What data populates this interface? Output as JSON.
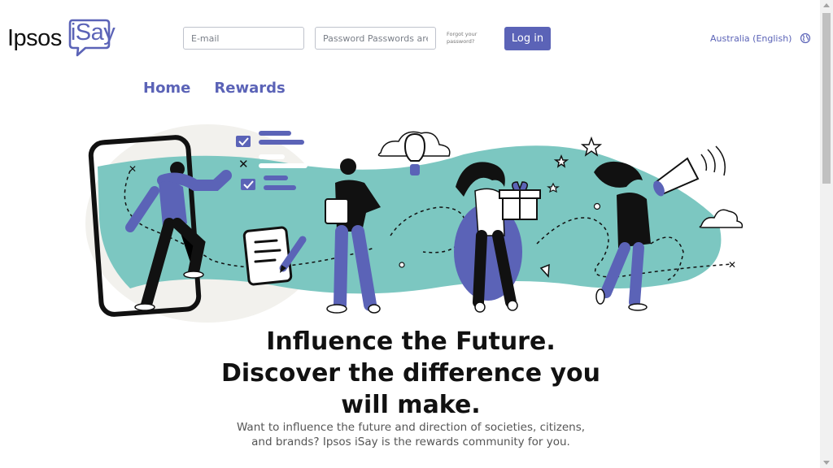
{
  "header": {
    "logo_brand": "Ipsos",
    "logo_product": "iSay",
    "email_placeholder": "E-mail",
    "password_placeholder": "Password Passwords are",
    "forgot_password": "Forgot your password?",
    "login_label": "Log in",
    "language": "Australia (English)"
  },
  "nav": {
    "items": [
      {
        "label": "Home"
      },
      {
        "label": "Rewards"
      }
    ]
  },
  "hero": {
    "headline": "Influence the Future. Discover the difference you will make.",
    "subline": "Want to influence the future and direction of societies, citizens, and brands? Ipsos iSay is the rewards community for you."
  },
  "colors": {
    "brand": "#5b63b7",
    "teal": "#7cc7c1",
    "ink": "#111111"
  },
  "icons": [
    "speech-bubble-icon",
    "globe-icon"
  ]
}
